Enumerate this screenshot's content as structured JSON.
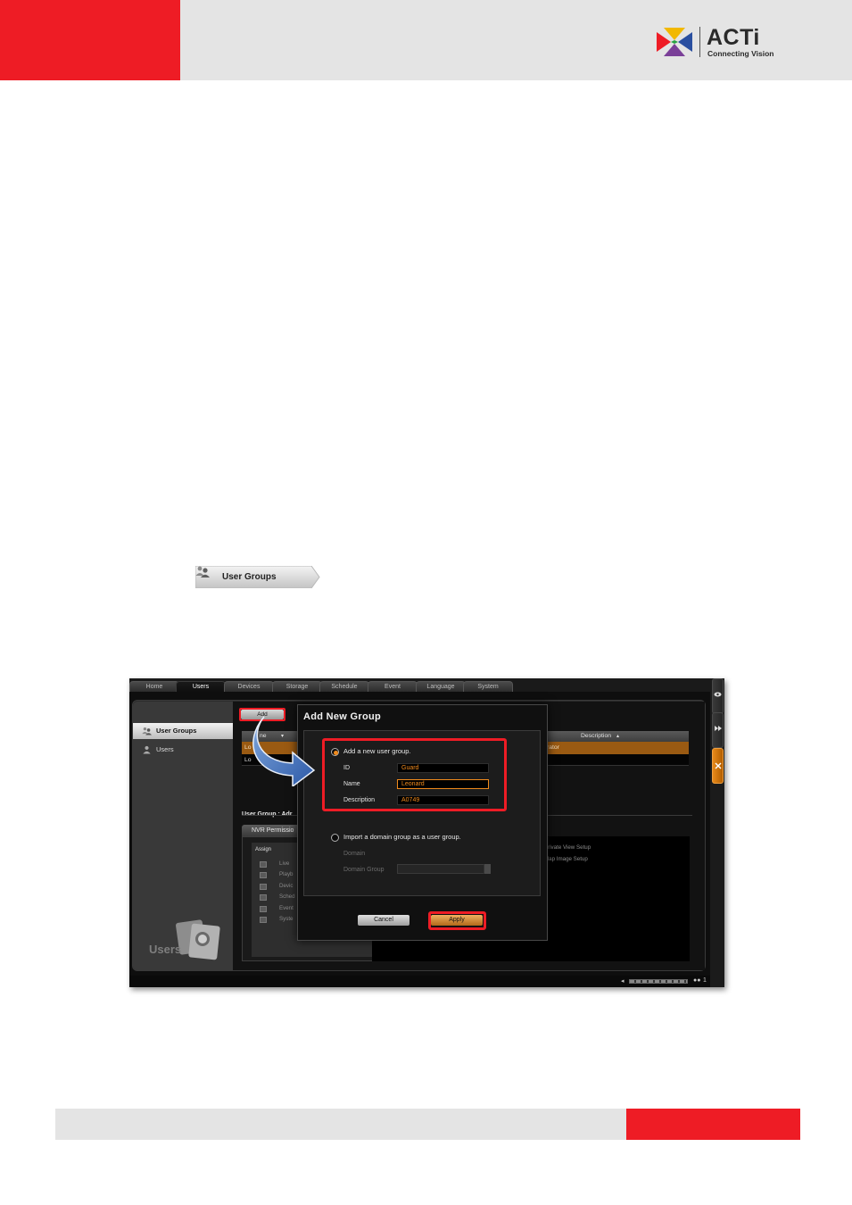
{
  "brand": {
    "name": "ACTi",
    "tagline": "Connecting Vision",
    "colors": {
      "accent_red": "#ee1c25",
      "header_gray": "#e4e4e4",
      "highlight_orange": "#f08a1c"
    }
  },
  "inline_button": {
    "label": "User Groups",
    "icon": "user-group-icon"
  },
  "app": {
    "tabs": [
      "Home",
      "Users",
      "Devices",
      "Storage",
      "Schedule",
      "Event",
      "Language",
      "System"
    ],
    "active_tab": "Users",
    "sidebar": {
      "items": [
        {
          "label": "User Groups",
          "icon": "user-group-icon",
          "active": true
        },
        {
          "label": "Users",
          "icon": "user-icon",
          "active": false
        }
      ],
      "watermark": "Users"
    },
    "toolbar": {
      "add_label": "Add"
    },
    "grid": {
      "col_name": "ne",
      "col_description": "Description",
      "rows": [
        {
          "name": "Lo",
          "description": "rator"
        },
        {
          "name": "Lo",
          "description": ""
        }
      ]
    },
    "group_detail_label": "User Group : Adr",
    "permissions_tab": "NVR Permissio",
    "assign_header": "Assign",
    "permissions": [
      "Live",
      "Playb",
      "Devic",
      "Sched",
      "Event",
      "Syste"
    ],
    "right_permissions": [
      "Private View Setup",
      "Map Image Setup"
    ],
    "status_count": "1",
    "dialog": {
      "title": "Add New Group",
      "option_new": "Add a new user group.",
      "option_domain": "Import a domain group as a user group.",
      "id_label": "ID",
      "id_value": "Guard",
      "name_label": "Name",
      "name_value": "Leonard",
      "description_label": "Description",
      "description_value": "A0749",
      "domain_label": "Domain",
      "domain_group_label": "Domain Group",
      "cancel_label": "Cancel",
      "apply_label": "Apply"
    }
  }
}
